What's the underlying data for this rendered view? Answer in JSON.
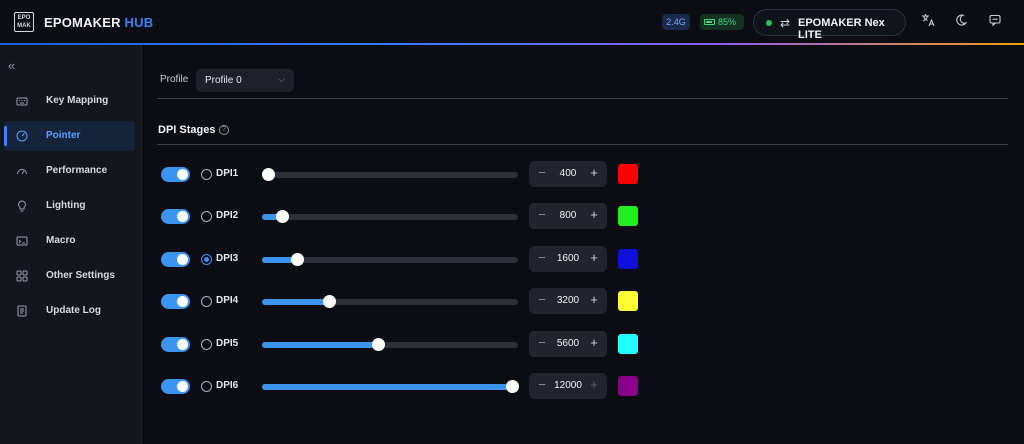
{
  "app": {
    "brand_main": "EPOMAKER",
    "brand_accent": "HUB",
    "logo_text": "EPO MAKER"
  },
  "header": {
    "connection": "2.4G",
    "battery": "85%",
    "device_name": "EPOMAKER Nex LITE",
    "icons": [
      "swap-icon",
      "translate-icon",
      "moon-icon",
      "message-icon"
    ]
  },
  "sidebar": {
    "items": [
      {
        "label": "Key Mapping",
        "icon": "keyboard-icon",
        "active": false
      },
      {
        "label": "Pointer",
        "icon": "pointer-icon",
        "active": true
      },
      {
        "label": "Performance",
        "icon": "gauge-icon",
        "active": false
      },
      {
        "label": "Lighting",
        "icon": "bulb-icon",
        "active": false
      },
      {
        "label": "Macro",
        "icon": "macro-icon",
        "active": false
      },
      {
        "label": "Other Settings",
        "icon": "grid-icon",
        "active": false
      },
      {
        "label": "Update Log",
        "icon": "document-icon",
        "active": false
      }
    ]
  },
  "profile": {
    "label": "Profile",
    "value": "Profile 0"
  },
  "dpi": {
    "title": "DPI Stages",
    "max": 12000,
    "stages": [
      {
        "label": "DPI1",
        "value": "400",
        "enabled": true,
        "selected": false,
        "color": "#ff0000",
        "level": 0.0
      },
      {
        "label": "DPI2",
        "value": "800",
        "enabled": true,
        "selected": false,
        "color": "#22ee22",
        "level": 0.058
      },
      {
        "label": "DPI3",
        "value": "1600",
        "enabled": true,
        "selected": true,
        "color": "#1010dd",
        "level": 0.12
      },
      {
        "label": "DPI4",
        "value": "3200",
        "enabled": true,
        "selected": false,
        "color": "#ffff33",
        "level": 0.25
      },
      {
        "label": "DPI5",
        "value": "5600",
        "enabled": true,
        "selected": false,
        "color": "#22ffff",
        "level": 0.45
      },
      {
        "label": "DPI6",
        "value": "12000",
        "enabled": true,
        "selected": false,
        "color": "#880088",
        "level": 1.0
      }
    ]
  },
  "colors": {
    "accent": "#3b93f2",
    "battery": "#3ddc84",
    "connection": "#7aa7ff"
  }
}
